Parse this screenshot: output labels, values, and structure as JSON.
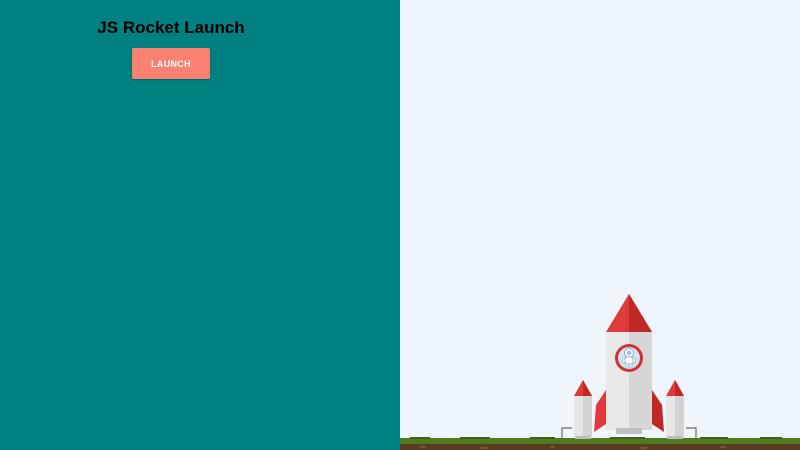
{
  "control_panel": {
    "title": "JS Rocket Launch",
    "launch_label": "LAUNCH"
  },
  "colors": {
    "panel_bg": "#008080",
    "sky_bg": "#eef6fc",
    "button_bg": "#fa8072",
    "rocket_red": "#e03a3a",
    "rocket_body": "#e6e6e6",
    "grass": "#4f7a1f",
    "soil": "#5a3a20"
  },
  "icons": {
    "rocket": "rocket-icon",
    "astronaut": "astronaut-icon"
  }
}
